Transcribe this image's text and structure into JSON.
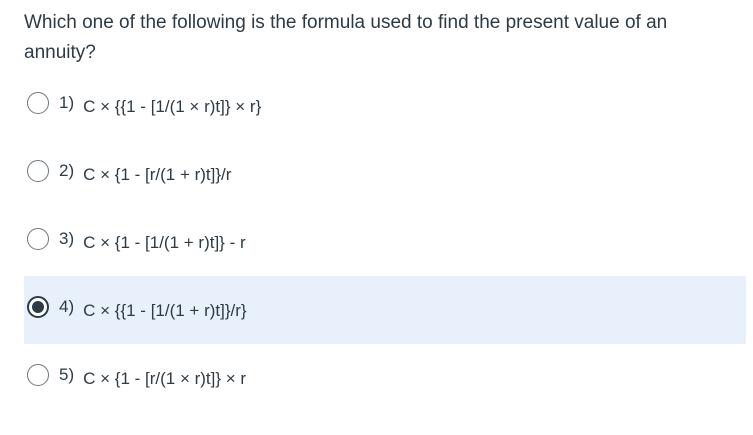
{
  "question": {
    "text": "Which one of the following is the formula used to find the present value of an annuity?"
  },
  "answers": [
    {
      "number": "1)",
      "formula": "C × {{1 - [1/(1 × r)t]} × r}",
      "selected": false
    },
    {
      "number": "2)",
      "formula": "C × {1 - [r/(1 + r)t]}/r",
      "selected": false
    },
    {
      "number": "3)",
      "formula": "C × {1 - [1/(1 + r)t]} - r",
      "selected": false
    },
    {
      "number": "4)",
      "formula": "C × {{1 - [1/(1 + r)t]}/r}",
      "selected": true
    },
    {
      "number": "5)",
      "formula": "C × {1 - [r/(1 × r)t]} × r",
      "selected": false
    }
  ],
  "colors": {
    "text": "#2d3b45",
    "selected_background": "#e8f0fb"
  }
}
